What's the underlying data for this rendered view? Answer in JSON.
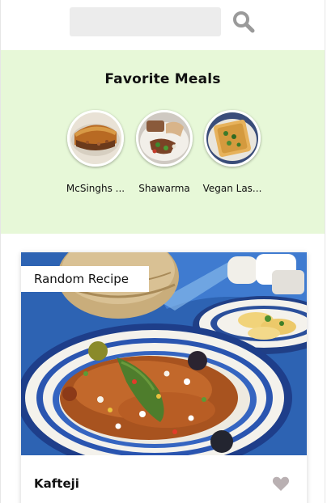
{
  "search": {
    "value": "",
    "placeholder": "",
    "button_icon": "search-icon"
  },
  "favorites": {
    "title": "Favorite Meals",
    "items": [
      {
        "label": "McSinghs ...",
        "image": "pie-dish-photo"
      },
      {
        "label": "Shawarma",
        "image": "shawarma-plate-photo"
      },
      {
        "label": "Vegan Las...",
        "image": "vegan-lasagna-photo"
      }
    ]
  },
  "meal_card": {
    "tag": "Random Recipe",
    "name": "Kafteji",
    "image": "kafteji-plate-photo",
    "favorite_icon": "heart-icon"
  },
  "colors": {
    "favorites_background": "#e7f8d8",
    "search_field": "#ececec",
    "search_icon": "#9a9a9a",
    "heart_icon": "#b9b0b2"
  }
}
